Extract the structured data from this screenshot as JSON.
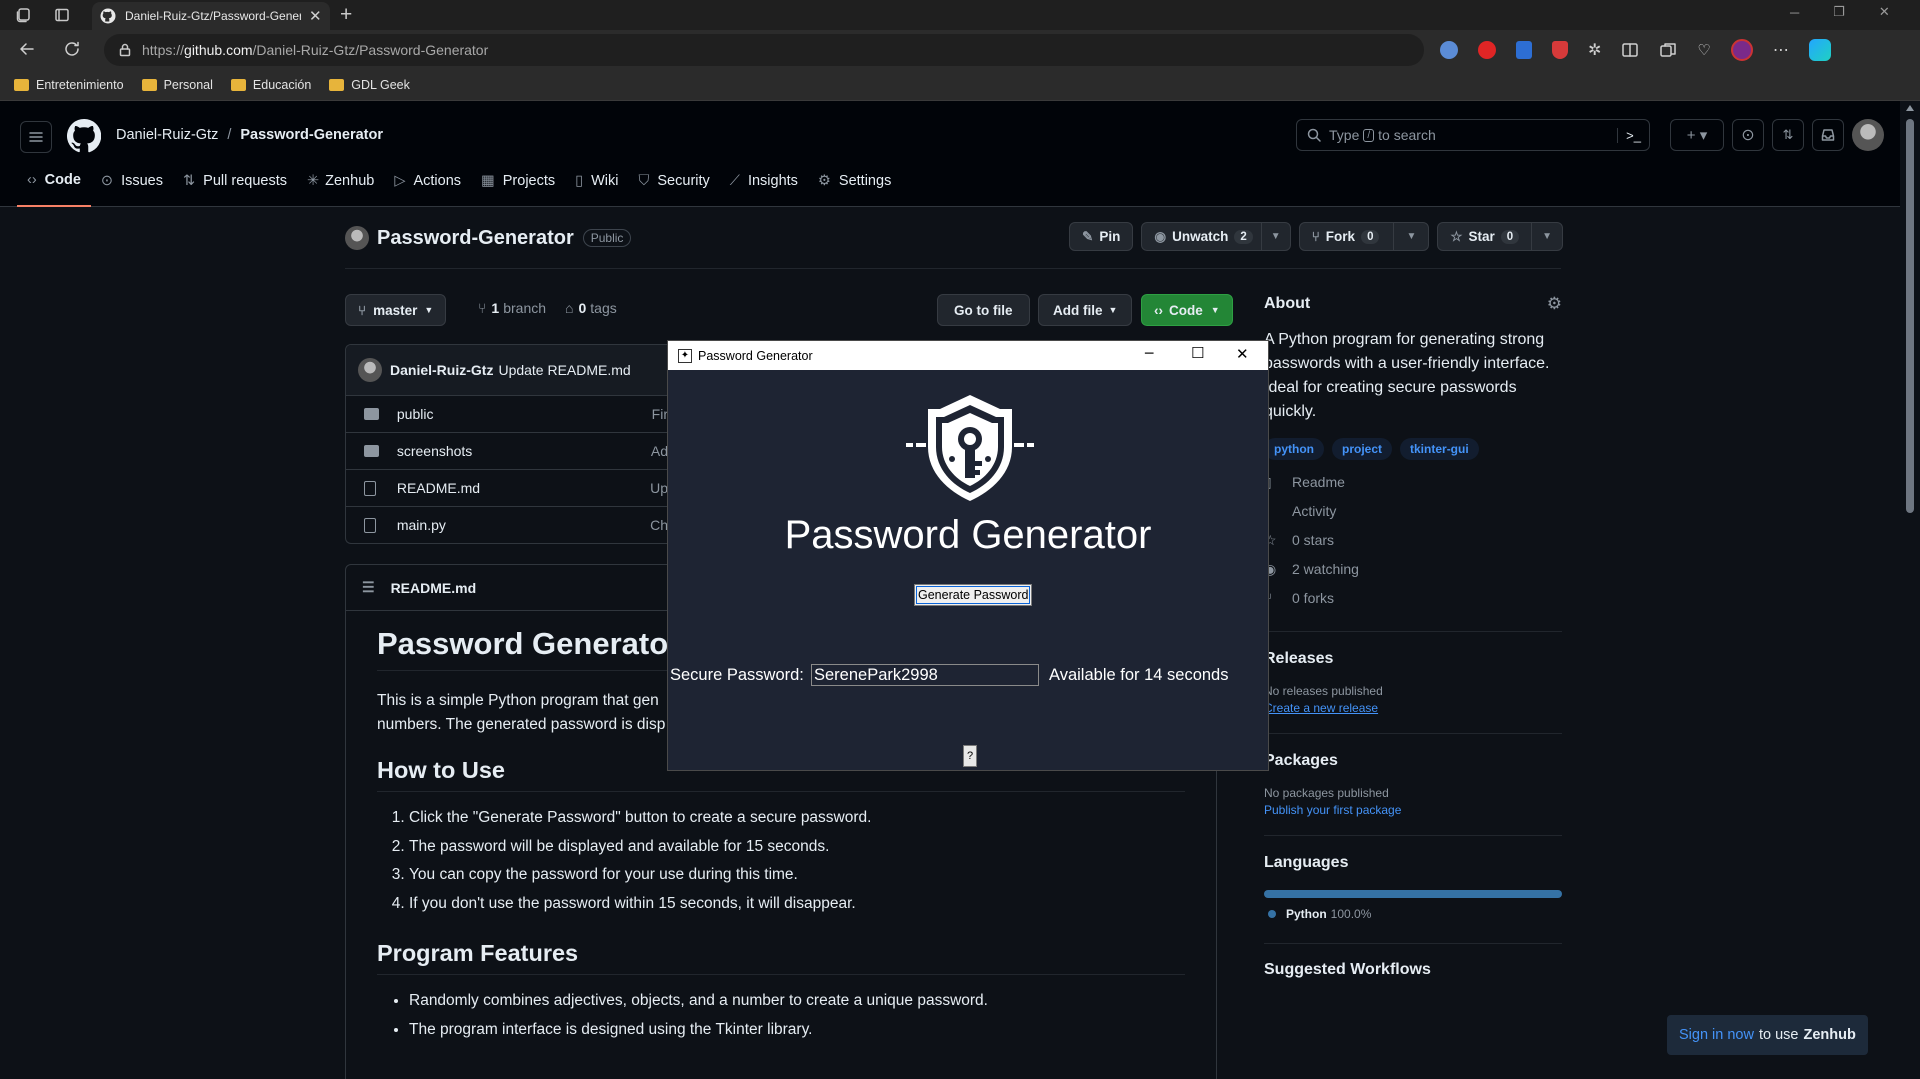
{
  "browser": {
    "tab_title": "Daniel-Ruiz-Gtz/Password-Generator",
    "url_prefix": "https://",
    "url_host": "github.com",
    "url_path": "/Daniel-Ruiz-Gtz/Password-Generator",
    "bookmarks": [
      "Entretenimiento",
      "Personal",
      "Educación",
      "GDL Geek"
    ]
  },
  "github": {
    "owner": "Daniel-Ruiz-Gtz",
    "repo": "Password-Generator",
    "search_placeholder_a": "Type",
    "search_key": "/",
    "search_placeholder_b": "to search",
    "tabs": [
      "Code",
      "Issues",
      "Pull requests",
      "Zenhub",
      "Actions",
      "Projects",
      "Wiki",
      "Security",
      "Insights",
      "Settings"
    ],
    "repo_name": "Password-Generator",
    "visibility": "Public",
    "pin": "Pin",
    "unwatch": "Unwatch",
    "unwatch_count": "2",
    "fork": "Fork",
    "fork_count": "0",
    "star": "Star",
    "star_count": "0",
    "branch_name": "master",
    "branch_count": "1",
    "branch_label": "branch",
    "tag_count": "0",
    "tag_label": "tags",
    "go_to_file": "Go to file",
    "add_file": "Add file",
    "code_button": "Code",
    "commit_author": "Daniel-Ruiz-Gtz",
    "commit_message": "Update README.md",
    "files": [
      {
        "name": "public",
        "msg": "Fir"
      },
      {
        "name": "screenshots",
        "msg": "Ad"
      },
      {
        "name": "README.md",
        "msg": "Up"
      },
      {
        "name": "main.py",
        "msg": "Ch"
      }
    ],
    "readme_file": "README.md",
    "readme_title": "Password Generator",
    "readme_intro_1": "This is a simple Python program that gen",
    "readme_intro_2": "numbers. The generated password is disp",
    "how_to_use": "How to Use",
    "steps": [
      "Click the \"Generate Password\" button to create a secure password.",
      "The password will be displayed and available for 15 seconds.",
      "You can copy the password for your use during this time.",
      "If you don't use the password within 15 seconds, it will disappear."
    ],
    "features_title": "Program Features",
    "features": [
      "Randomly combines adjectives, objects, and a number to create a unique password.",
      "The program interface is designed using the Tkinter library."
    ],
    "about_title": "About",
    "about_lines": [
      "A Python program for generating strong",
      "passwords with a user-friendly interface.",
      "Ideal for creating secure passwords",
      "quickly."
    ],
    "topics": [
      "python",
      "project",
      "tkinter-gui"
    ],
    "meta": [
      "Readme",
      "Activity",
      "0 stars",
      "2 watching",
      "0 forks"
    ],
    "releases_title": "Releases",
    "releases_none": "No releases published",
    "releases_link": "Create a new release",
    "packages_title": "Packages",
    "packages_none": "No packages published",
    "packages_link": "Publish your first package",
    "languages_title": "Languages",
    "language": "Python",
    "language_pct": "100.0%",
    "language_share": 1.0,
    "suggested_title": "Suggested Workflows",
    "zenhub_link": "Sign in now",
    "zenhub_text": "to use",
    "zenhub_brand": "Zenhub"
  },
  "app": {
    "window_title": "Password Generator",
    "heading": "Password Generator",
    "generate_button": "Generate Password",
    "password_label": "Secure Password:",
    "password_value": "SerenePark2998",
    "availability": "Available for 14 seconds",
    "help_button": "?"
  },
  "colors": {
    "accent_green": "#238636",
    "link_blue": "#4493f8",
    "language_python": "#3572a5",
    "app_background": "#1e2433"
  }
}
